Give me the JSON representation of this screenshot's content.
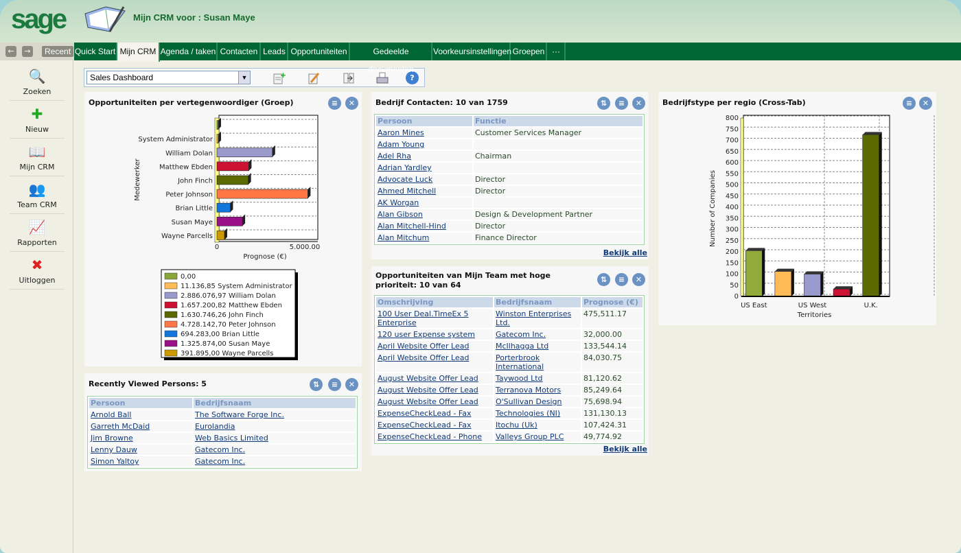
{
  "header": {
    "logo": "sage",
    "title": "Mijn CRM voor : Susan Maye"
  },
  "nav": {
    "back": "←",
    "forward": "→",
    "recent": "Recent",
    "tabs": [
      "Quick Start",
      "Mijn CRM",
      "Agenda / taken",
      "Contacten",
      "Leads",
      "Opportuniteiten",
      "Gedeelde documenten",
      "Voorkeursinstellingen",
      "Groepen",
      "···"
    ],
    "active": 1
  },
  "sidebar": [
    {
      "label": "Zoeken",
      "icon": "search-icon"
    },
    {
      "label": "Nieuw",
      "icon": "new-icon"
    },
    {
      "label": "Mijn CRM",
      "icon": "my-crm-icon"
    },
    {
      "label": "Team CRM",
      "icon": "team-icon"
    },
    {
      "label": "Rapporten",
      "icon": "reports-icon"
    },
    {
      "label": "Uitloggen",
      "icon": "logout-icon"
    }
  ],
  "toolbar": {
    "dashboard": "Sales Dashboard",
    "icons": [
      "add-gadget-icon",
      "edit-icon",
      "layout-icon",
      "print-icon",
      "help-icon"
    ]
  },
  "colors": {
    "nav": "#006633",
    "header_text": "#156a2e",
    "link": "#103a78",
    "table_header": "#ccd9e8"
  },
  "panels": {
    "opps_chart": {
      "title": "Opportuniteiten per vertegenwoordiger (Groep)"
    },
    "contacts": {
      "title": "Bedrijf Contacten: 10 van 1759",
      "columns": [
        "Persoon",
        "Functie"
      ],
      "rows": [
        [
          "Aaron Mines",
          "Customer Services Manager"
        ],
        [
          "Adam Young",
          ""
        ],
        [
          "Adel Rha",
          "Chairman"
        ],
        [
          "Adrian Yardley",
          ""
        ],
        [
          "Advocate Luck",
          "Director"
        ],
        [
          "Ahmed Mitchell",
          "Director"
        ],
        [
          "AK Worgan",
          ""
        ],
        [
          "Alan Gibson",
          "Design & Development Partner"
        ],
        [
          "Alan Mitchell-Hind",
          "Director"
        ],
        [
          "Alan Mitchum",
          "Finance Director"
        ]
      ],
      "more": "Bekijk alle"
    },
    "team_opps": {
      "title": "Opportuniteiten van Mijn Team met hoge prioriteit: 10 van 64",
      "columns": [
        "Omschrijving",
        "Bedrijfsnaam",
        "Prognose (€)"
      ],
      "rows": [
        [
          "100 User Deal.TimeEx 5 Enterprise",
          "Winston Enterprises Ltd.",
          "475,511.17"
        ],
        [
          "120 user Expense system",
          "Gatecom Inc.",
          "32,000.00"
        ],
        [
          "April Website Offer Lead",
          "McIlhagga Ltd",
          "133,544.14"
        ],
        [
          "April Website Offer Lead",
          "Porterbrook International",
          "84,030.75"
        ],
        [
          "August Website Offer Lead",
          "Taywood Ltd",
          "81,120.62"
        ],
        [
          "August Website Offer Lead",
          "Terranova Motors",
          "85,249.64"
        ],
        [
          "August Website Offer Lead",
          "O'Sullivan Design",
          "75,698.94"
        ],
        [
          "ExpenseCheckLead - Fax",
          "Technologies (NI)",
          "131,130.13"
        ],
        [
          "ExpenseCheckLead - Fax",
          "Itochu (Uk)",
          "107,424.31"
        ],
        [
          "ExpenseCheckLead - Phone",
          "Valleys Group PLC",
          "49,774.92"
        ]
      ],
      "more": "Bekijk alle"
    },
    "region_chart": {
      "title": "Bedrijfstype per regio (Cross-Tab)"
    },
    "recent": {
      "title": "Recently Viewed Persons: 5",
      "columns": [
        "Persoon",
        "Bedrijfsnaam"
      ],
      "rows": [
        [
          "Arnold Ball",
          "The Software Forge Inc."
        ],
        [
          "Garreth McDaid",
          "Eurolandia"
        ],
        [
          "Jim Browne",
          "Web Basics Limited"
        ],
        [
          "Lenny Dauw",
          "Gatecom Inc."
        ],
        [
          "Simon Yaltoy",
          "Gatecom Inc."
        ]
      ]
    }
  },
  "chart_data": [
    {
      "type": "bar",
      "orientation": "horizontal",
      "xlabel": "Prognose (€)",
      "ylabel": "Medewerker",
      "xticks": [
        "0",
        "5.000.00"
      ],
      "xlim": [
        0,
        5000000
      ],
      "grid": true,
      "legend": "bottom",
      "categories": [
        "",
        "System Administrator",
        "William Dolan",
        "Matthew Ebden",
        "John Finch",
        "Peter Johnson",
        "Brian Little",
        "Susan Maye",
        "Wayne Parcells"
      ],
      "values": [
        0,
        11136.85,
        2886076.97,
        1657200.82,
        1630746.26,
        4728142.7,
        694283.0,
        1325874.0,
        391895.0
      ],
      "legend_labels": [
        "0,00",
        "11.136,85 System Administrator",
        "2.886.076,97 William Dolan",
        "1.657.200,82 Matthew Ebden",
        "1.630.746,26 John Finch",
        "4.728.142,70 Peter Johnson",
        "694.283,00 Brian Little",
        "1.325.874,00 Susan Maye",
        "391.895,00 Wayne Parcells"
      ],
      "colors": [
        "#8aa63a",
        "#ffbb55",
        "#9999cc",
        "#cc1133",
        "#5a6a00",
        "#ff7744",
        "#1177dd",
        "#991188",
        "#cc9900"
      ]
    },
    {
      "type": "bar",
      "xlabel": "Territories",
      "ylabel": "Number of Companies",
      "ylim": [
        0,
        800
      ],
      "yticks": [
        0,
        50,
        100,
        150,
        200,
        250,
        300,
        350,
        400,
        450,
        500,
        550,
        600,
        650,
        700,
        750,
        800
      ],
      "grid": true,
      "categories": [
        "US East",
        "",
        "US West",
        "",
        "U.K."
      ],
      "values": [
        205,
        112,
        100,
        33,
        725
      ],
      "colors": [
        "#92aa3a",
        "#ffbb55",
        "#9999cc",
        "#cc1133",
        "#5a6a00"
      ]
    }
  ]
}
